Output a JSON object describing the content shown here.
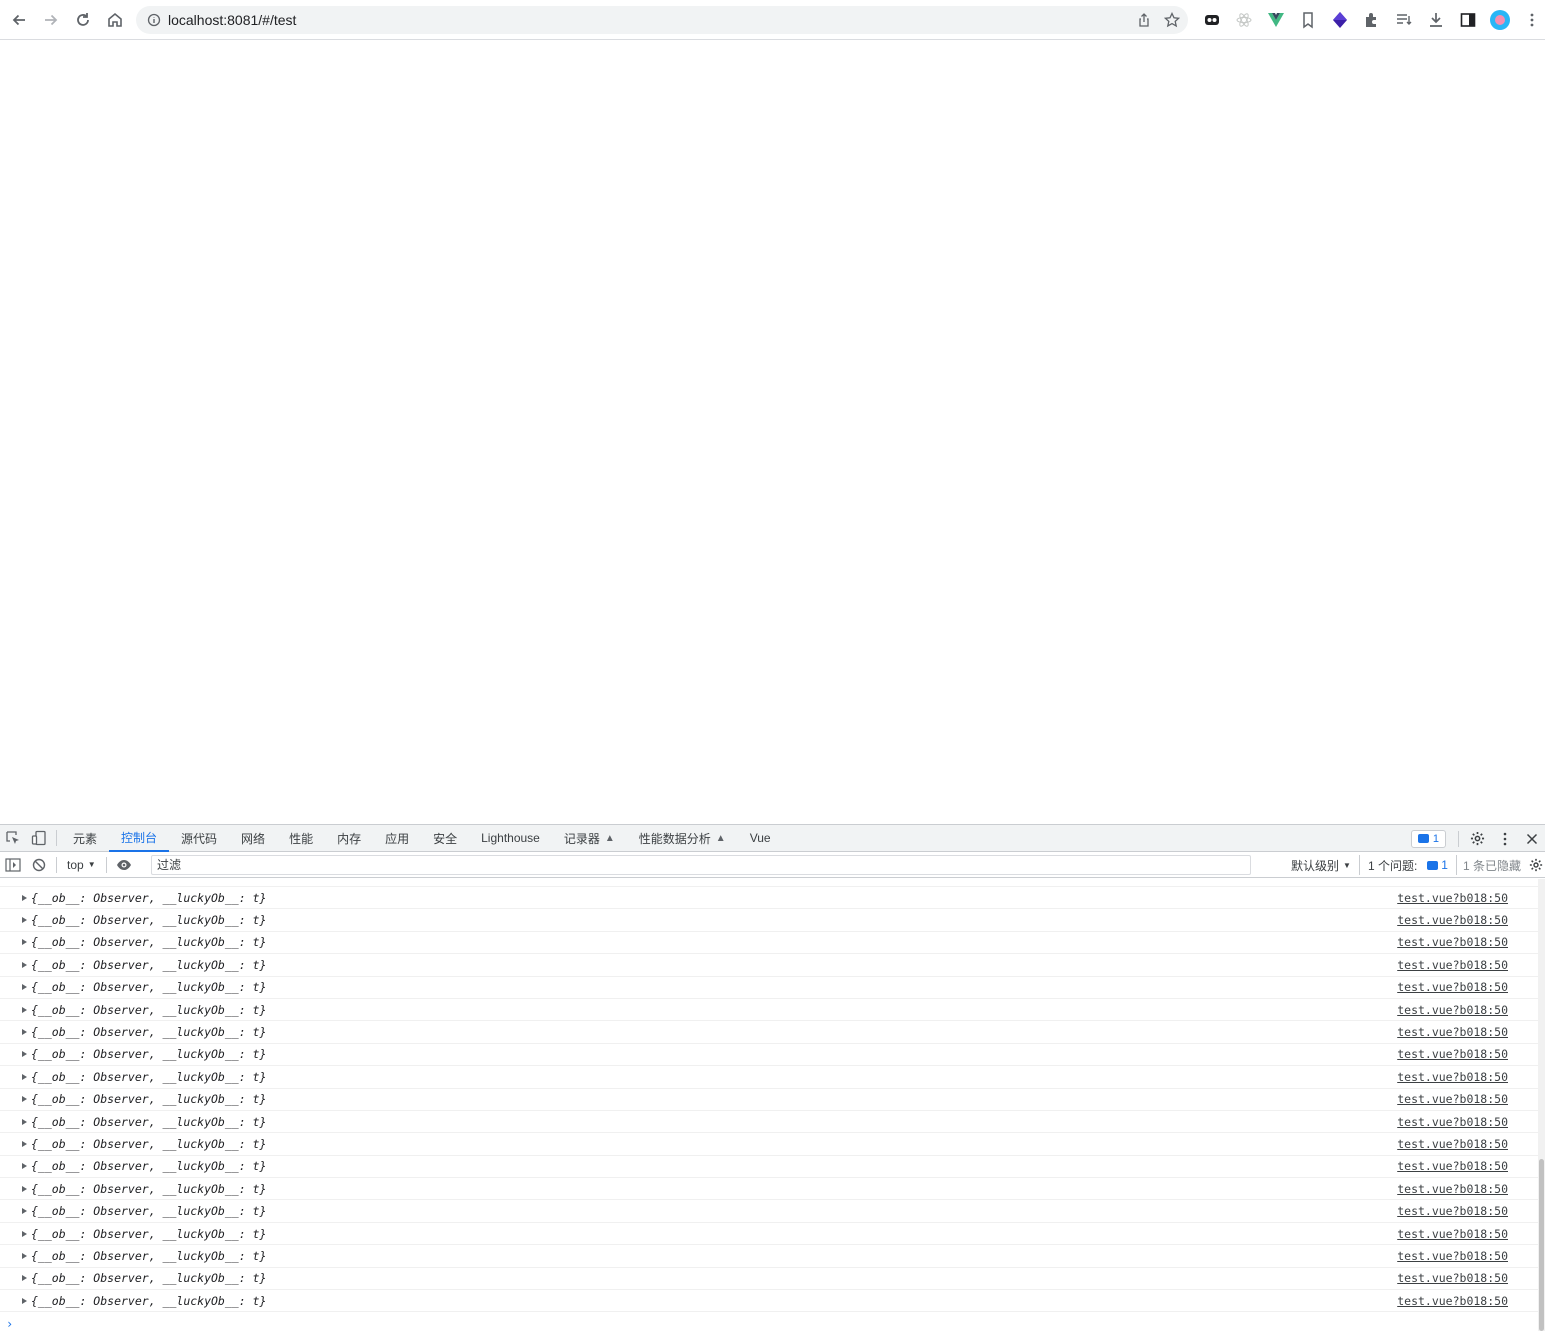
{
  "browser": {
    "url": "localhost:8081/#/test"
  },
  "devtools": {
    "tabs": [
      {
        "label": "元素",
        "active": false
      },
      {
        "label": "控制台",
        "active": true
      },
      {
        "label": "源代码",
        "active": false
      },
      {
        "label": "网络",
        "active": false
      },
      {
        "label": "性能",
        "active": false
      },
      {
        "label": "内存",
        "active": false
      },
      {
        "label": "应用",
        "active": false
      },
      {
        "label": "安全",
        "active": false
      },
      {
        "label": "Lighthouse",
        "active": false
      },
      {
        "label": "记录器",
        "active": false,
        "experimental": true
      },
      {
        "label": "性能数据分析",
        "active": false,
        "experimental": true
      },
      {
        "label": "Vue",
        "active": false
      }
    ],
    "issue_count": "1",
    "toolbar": {
      "context": "top",
      "filter_placeholder": "过滤",
      "level": "默认级别",
      "issues_label": "1 个问题:",
      "issues_count": "1",
      "hidden_label": "1 条已隐藏"
    },
    "console_rows": [
      {
        "msg": "{__ob__: Observer, __luckyOb__: t}",
        "src": "test.vue?b018:50"
      },
      {
        "msg": "{__ob__: Observer, __luckyOb__: t}",
        "src": "test.vue?b018:50"
      },
      {
        "msg": "{__ob__: Observer, __luckyOb__: t}",
        "src": "test.vue?b018:50"
      },
      {
        "msg": "{__ob__: Observer, __luckyOb__: t}",
        "src": "test.vue?b018:50"
      },
      {
        "msg": "{__ob__: Observer, __luckyOb__: t}",
        "src": "test.vue?b018:50"
      },
      {
        "msg": "{__ob__: Observer, __luckyOb__: t}",
        "src": "test.vue?b018:50"
      },
      {
        "msg": "{__ob__: Observer, __luckyOb__: t}",
        "src": "test.vue?b018:50"
      },
      {
        "msg": "{__ob__: Observer, __luckyOb__: t}",
        "src": "test.vue?b018:50"
      },
      {
        "msg": "{__ob__: Observer, __luckyOb__: t}",
        "src": "test.vue?b018:50"
      },
      {
        "msg": "{__ob__: Observer, __luckyOb__: t}",
        "src": "test.vue?b018:50"
      },
      {
        "msg": "{__ob__: Observer, __luckyOb__: t}",
        "src": "test.vue?b018:50"
      },
      {
        "msg": "{__ob__: Observer, __luckyOb__: t}",
        "src": "test.vue?b018:50"
      },
      {
        "msg": "{__ob__: Observer, __luckyOb__: t}",
        "src": "test.vue?b018:50"
      },
      {
        "msg": "{__ob__: Observer, __luckyOb__: t}",
        "src": "test.vue?b018:50"
      },
      {
        "msg": "{__ob__: Observer, __luckyOb__: t}",
        "src": "test.vue?b018:50"
      },
      {
        "msg": "{__ob__: Observer, __luckyOb__: t}",
        "src": "test.vue?b018:50"
      },
      {
        "msg": "{__ob__: Observer, __luckyOb__: t}",
        "src": "test.vue?b018:50"
      },
      {
        "msg": "{__ob__: Observer, __luckyOb__: t}",
        "src": "test.vue?b018:50"
      },
      {
        "msg": "{__ob__: Observer, __luckyOb__: t}",
        "src": "test.vue?b018:50"
      }
    ]
  }
}
